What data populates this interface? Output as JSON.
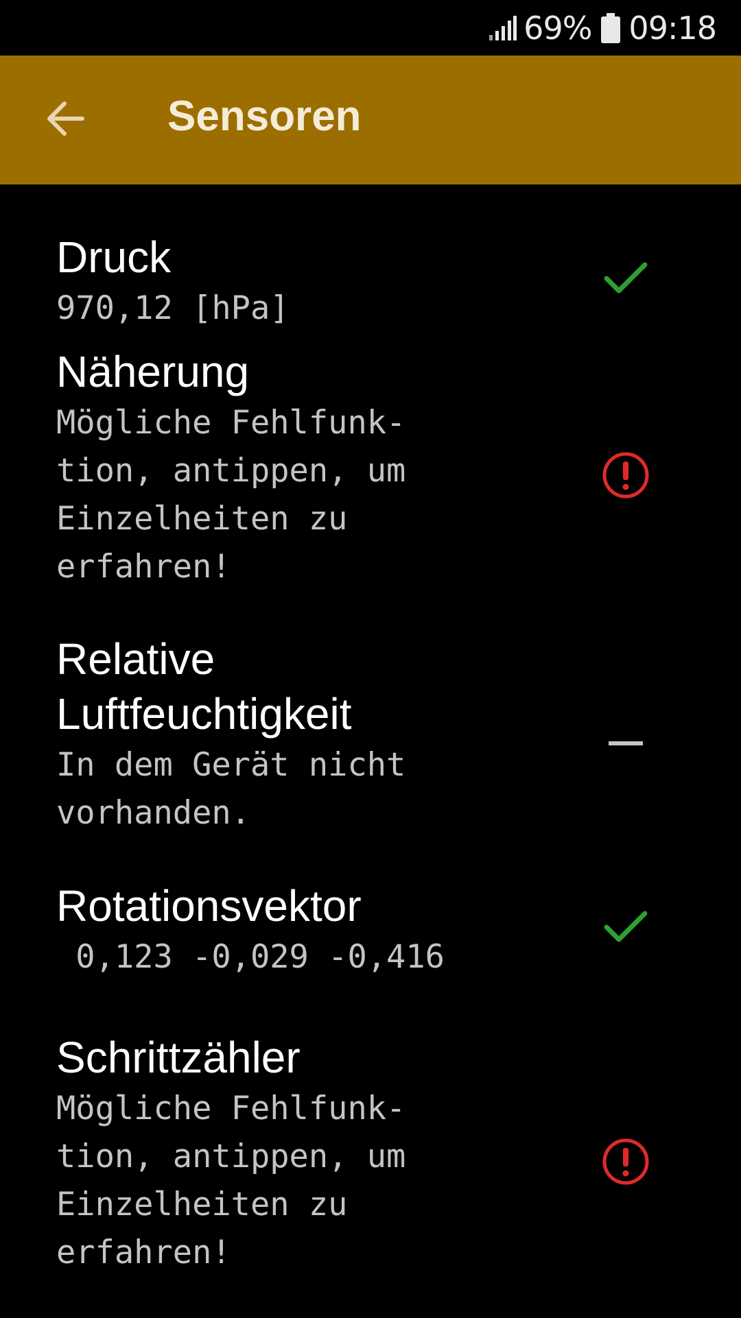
{
  "status_bar": {
    "battery_percent": "69%",
    "time": "09:18"
  },
  "app_bar": {
    "title": "Sensoren",
    "back_icon": "arrow-back-icon"
  },
  "colors": {
    "app_bar": "#9c6e00",
    "ok": "#2fa032",
    "error": "#e02a2a",
    "unavailable": "#c4c4c4"
  },
  "sensors": [
    {
      "title": "Druck",
      "subtitle": "970,12 [hPa]",
      "status": "ok",
      "status_icon": "checkmark-icon"
    },
    {
      "title": "Näherung",
      "subtitle": "Mögliche Fehlfunk-\ntion, antippen, um\nEinzelheiten zu\nerfahren!",
      "status": "error",
      "status_icon": "error-circle-icon"
    },
    {
      "title": "Relative\nLuftfeuchtigkeit",
      "subtitle": "In dem Gerät nicht\nvorhanden.",
      "status": "unavailable",
      "status_icon": "dash-icon"
    },
    {
      "title": "Rotationsvektor",
      "subtitle": " 0,123 -0,029 -0,416",
      "status": "ok",
      "status_icon": "checkmark-icon"
    },
    {
      "title": "Schrittzähler",
      "subtitle": "Mögliche Fehlfunk-\ntion, antippen, um\nEinzelheiten zu\nerfahren!",
      "status": "error",
      "status_icon": "error-circle-icon"
    }
  ]
}
